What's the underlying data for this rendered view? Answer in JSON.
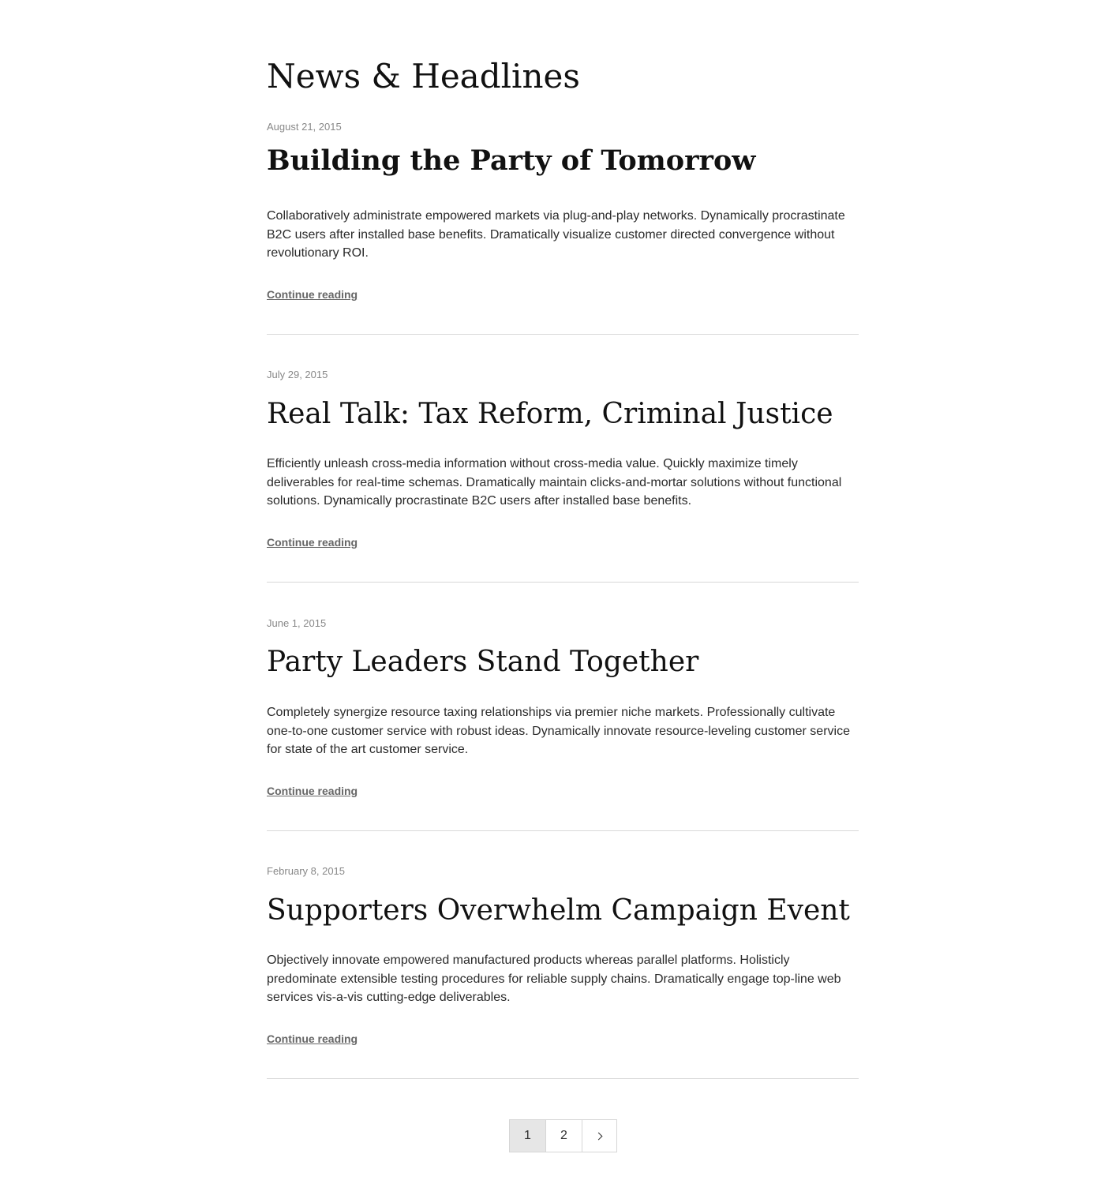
{
  "page": {
    "title": "News & Headlines"
  },
  "posts": [
    {
      "date": "August 21, 2015",
      "title": "Building the Party of Tomorrow",
      "excerpt": "Collaboratively administrate empowered markets via plug-and-play networks. Dynamically procrastinate B2C users after installed base benefits. Dramatically visualize customer directed convergence without revolutionary ROI.",
      "read_more": "Continue reading"
    },
    {
      "date": "July 29, 2015",
      "title": "Real Talk: Tax Reform, Criminal Justice",
      "excerpt": "Efficiently unleash cross-media information without cross-media value. Quickly maximize timely deliverables for real-time schemas. Dramatically maintain clicks-and-mortar solutions without functional solutions. Dynamically procrastinate B2C users after installed base benefits.",
      "read_more": "Continue reading"
    },
    {
      "date": "June 1, 2015",
      "title": "Party Leaders Stand Together",
      "excerpt": "Completely synergize resource taxing relationships via premier niche markets. Professionally cultivate one-to-one customer service with robust ideas. Dynamically innovate resource-leveling customer service for state of the art customer service.",
      "read_more": "Continue reading"
    },
    {
      "date": "February 8, 2015",
      "title": "Supporters Overwhelm Campaign Event",
      "excerpt": "Objectively innovate empowered manufactured products whereas parallel platforms. Holisticly predominate extensible testing procedures for reliable supply chains. Dramatically engage top-line web services vis-a-vis cutting-edge deliverables.",
      "read_more": "Continue reading"
    }
  ],
  "pagination": {
    "current": "1",
    "next_page": "2",
    "next_icon": "chevron-right-icon"
  }
}
